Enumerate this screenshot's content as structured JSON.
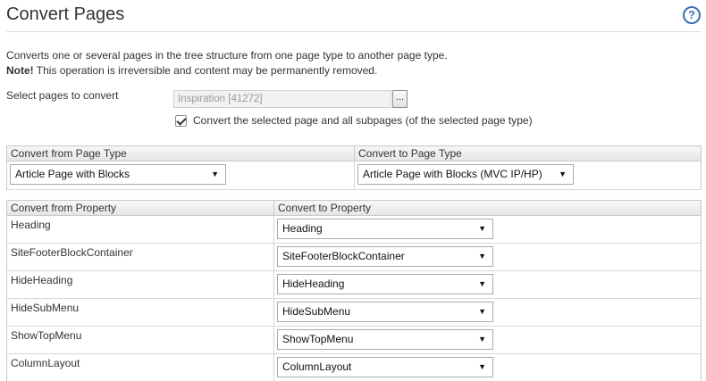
{
  "header": {
    "title": "Convert Pages",
    "help_icon": "?"
  },
  "intro": {
    "description": "Converts one or several pages in the tree structure from one page type to another page type.",
    "note_label": "Note!",
    "note_text": " This operation is irreversible and content may be permanently removed."
  },
  "page_select": {
    "label": "Select pages to convert",
    "value": "Inspiration [41272]",
    "browse_label": "...",
    "include_subpages_checked": true,
    "include_subpages_label": "Convert the selected page and all subpages (of the selected page type)"
  },
  "page_types": {
    "from_header": "Convert from Page Type",
    "to_header": "Convert to Page Type",
    "from_value": "Article Page with Blocks",
    "to_value": "Article Page with Blocks (MVC IP/HP)"
  },
  "properties": {
    "from_header": "Convert from Property",
    "to_header": "Convert to Property",
    "rows": [
      {
        "from": "Heading",
        "to": "Heading"
      },
      {
        "from": "SiteFooterBlockContainer",
        "to": "SiteFooterBlockContainer"
      },
      {
        "from": "HideHeading",
        "to": "HideHeading"
      },
      {
        "from": "HideSubMenu",
        "to": "HideSubMenu"
      },
      {
        "from": "ShowTopMenu",
        "to": "ShowTopMenu"
      },
      {
        "from": "ColumnLayout",
        "to": "ColumnLayout"
      }
    ]
  },
  "colors": {
    "help_accent": "#3b6fb5",
    "header_bg": "#eaeaea",
    "border": "#c9c9c9"
  }
}
